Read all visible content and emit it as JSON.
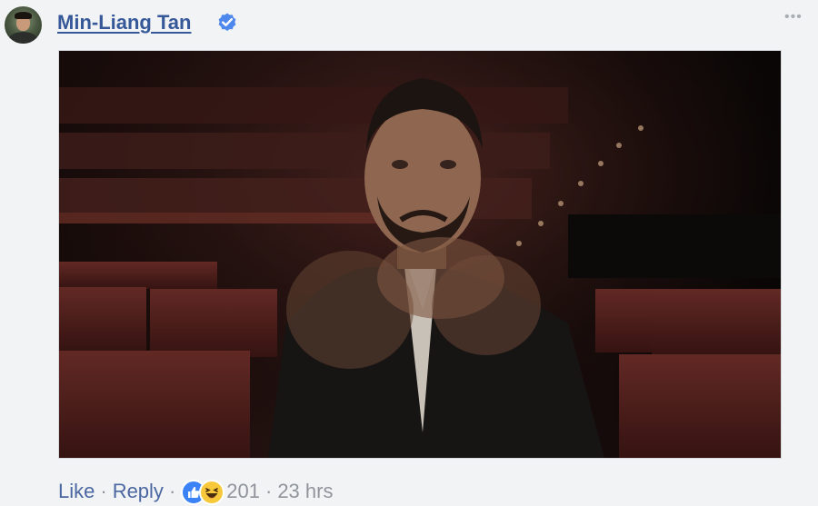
{
  "comment": {
    "author": "Min-Liang Tan",
    "verified_icon": "verified-badge-icon",
    "more_icon": "more-options-icon",
    "more_glyph": "•••",
    "media": {
      "kind": "animated-gif"
    },
    "actions": {
      "like_label": "Like",
      "separator": "·",
      "reply_label": "Reply",
      "reaction_icons": [
        "like-reaction-icon",
        "haha-reaction-icon"
      ],
      "reaction_count": "201",
      "timestamp": "23 hrs"
    }
  },
  "colors": {
    "background": "#f2f3f5",
    "author_link": "#365899",
    "action_link": "#4b67a1",
    "meta_text": "#90949c",
    "verified_badge": "#4f88ed",
    "like_blue": "#3b82f6",
    "haha_yellow": "#f7c93a"
  }
}
